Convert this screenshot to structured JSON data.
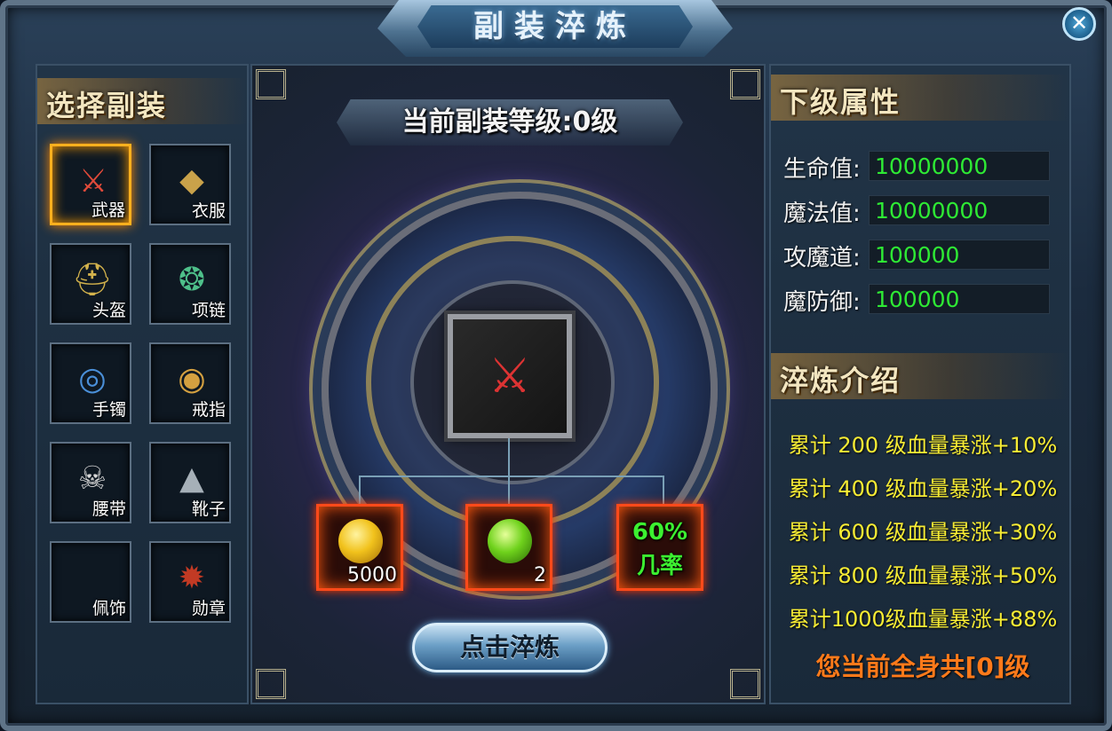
{
  "window": {
    "title": "副装淬炼",
    "close_icon": "close-x-icon"
  },
  "left_panel": {
    "title": "选择副装",
    "slots": [
      {
        "label": "武器",
        "icon": "sword-icon",
        "selected": true
      },
      {
        "label": "衣服",
        "icon": "armor-icon",
        "selected": false
      },
      {
        "label": "头盔",
        "icon": "helmet-icon",
        "selected": false
      },
      {
        "label": "项链",
        "icon": "necklace-icon",
        "selected": false
      },
      {
        "label": "手镯",
        "icon": "bracelet-icon",
        "selected": false
      },
      {
        "label": "戒指",
        "icon": "ring-icon",
        "selected": false
      },
      {
        "label": "腰带",
        "icon": "belt-icon",
        "selected": false
      },
      {
        "label": "靴子",
        "icon": "boots-icon",
        "selected": false
      },
      {
        "label": "佩饰",
        "icon": "",
        "selected": false
      },
      {
        "label": "勋章",
        "icon": "medal-icon",
        "selected": false
      }
    ]
  },
  "center_panel": {
    "level_text": "当前副装等级:0级",
    "item_icon": "sword-icon",
    "materials": [
      {
        "icon": "gold-coin-icon",
        "count": "5000"
      },
      {
        "icon": "green-orb-icon",
        "count": "2"
      }
    ],
    "rate": {
      "value": "60%",
      "label": "几率"
    },
    "refine_button": "点击淬炼"
  },
  "right_panel": {
    "next_title": "下级属性",
    "attributes": [
      {
        "label": "生命值:",
        "value": "10000000"
      },
      {
        "label": "魔法值:",
        "value": "10000000"
      },
      {
        "label": "攻魔道:",
        "value": "100000"
      },
      {
        "label": "魔防御:",
        "value": "100000"
      }
    ],
    "intro_title": "淬炼介绍",
    "bonuses": [
      "累计 200 级血量暴涨+10%",
      "累计 400 级血量暴涨+20%",
      "累计 600 级血量暴涨+30%",
      "累计 800 级血量暴涨+50%",
      "累计1000级血量暴涨+88%"
    ],
    "total_text": "您当前全身共[0]级"
  },
  "colors": {
    "attr_value": "#2eea34",
    "bonus_text": "#f7ec34",
    "total_text": "#ff7a1a",
    "selected_slot": "#ffb01e",
    "material_border": "#ff4a1a"
  }
}
